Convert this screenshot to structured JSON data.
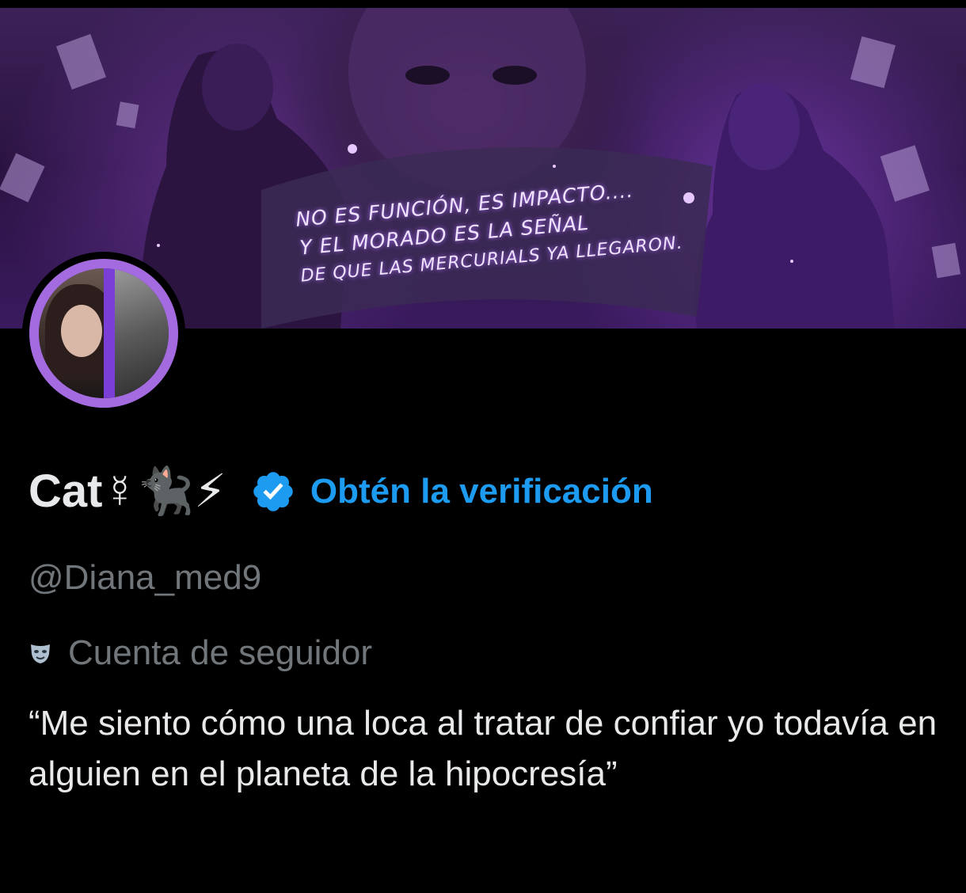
{
  "banner": {
    "text_lines": [
      "NO ES FUNCIÓN, ES IMPACTO....",
      "Y EL MORADO ES LA SEÑAL",
      "DE QUE LAS MERCURIALS YA LLEGARON."
    ]
  },
  "profile": {
    "display_name": "Cat☿🐈‍⬛⚡",
    "verify_link": "Obtén la verificación",
    "handle": "@Diana_med9",
    "account_type": "Cuenta de seguidor",
    "bio": "“Me siento cómo una loca al tratar de confiar yo todavía en alguien en el planeta de la hipocresía”"
  },
  "colors": {
    "background": "#000000",
    "accent_blue": "#1d9bf0",
    "muted_text": "#71767b",
    "primary_text": "#e7e9ea",
    "avatar_ring": "#a46be0"
  },
  "icons": {
    "badge": "verified-badge-icon",
    "account_type": "theater-mask-icon"
  }
}
